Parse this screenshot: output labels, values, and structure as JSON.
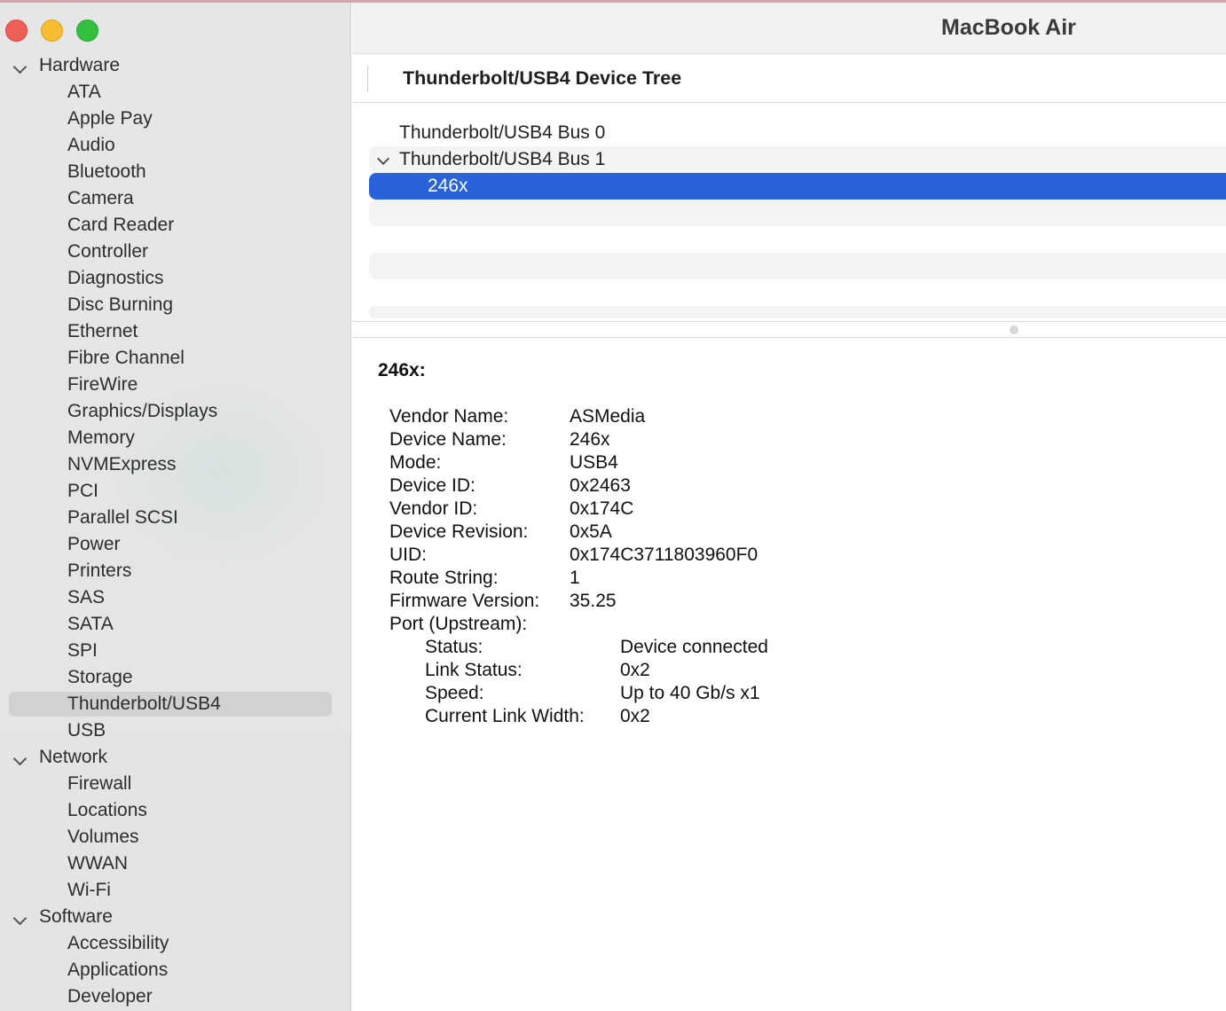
{
  "window": {
    "title": "MacBook Air"
  },
  "sidebar": {
    "groups": [
      {
        "label": "Hardware",
        "items": [
          "ATA",
          "Apple Pay",
          "Audio",
          "Bluetooth",
          "Camera",
          "Card Reader",
          "Controller",
          "Diagnostics",
          "Disc Burning",
          "Ethernet",
          "Fibre Channel",
          "FireWire",
          "Graphics/Displays",
          "Memory",
          "NVMExpress",
          "PCI",
          "Parallel SCSI",
          "Power",
          "Printers",
          "SAS",
          "SATA",
          "SPI",
          "Storage",
          "Thunderbolt/USB4",
          "USB"
        ]
      },
      {
        "label": "Network",
        "items": [
          "Firewall",
          "Locations",
          "Volumes",
          "WWAN",
          "Wi-Fi"
        ]
      },
      {
        "label": "Software",
        "items": [
          "Accessibility",
          "Applications",
          "Developer"
        ]
      }
    ],
    "selected": "Thunderbolt/USB4"
  },
  "header": {
    "title": "Thunderbolt/USB4 Device Tree"
  },
  "device_tree": {
    "bus0": "Thunderbolt/USB4 Bus 0",
    "bus1": "Thunderbolt/USB4 Bus 1",
    "device": "246x"
  },
  "detail": {
    "title": "246x:",
    "properties": [
      {
        "key": "Vendor Name:",
        "value": "ASMedia"
      },
      {
        "key": "Device Name:",
        "value": "246x"
      },
      {
        "key": "Mode:",
        "value": "USB4"
      },
      {
        "key": "Device ID:",
        "value": "0x2463"
      },
      {
        "key": "Vendor ID:",
        "value": "0x174C"
      },
      {
        "key": "Device Revision:",
        "value": "0x5A"
      },
      {
        "key": "UID:",
        "value": "0x174C3711803960F0"
      },
      {
        "key": "Route String:",
        "value": "1"
      },
      {
        "key": "Firmware Version:",
        "value": "35.25"
      },
      {
        "key": "Port (Upstream):",
        "value": ""
      }
    ],
    "port_properties": [
      {
        "key": "Status:",
        "value": "Device connected"
      },
      {
        "key": "Link Status:",
        "value": "0x2"
      },
      {
        "key": "Speed:",
        "value": "Up to 40 Gb/s x1"
      },
      {
        "key": "Current Link Width:",
        "value": "0x2"
      }
    ]
  }
}
